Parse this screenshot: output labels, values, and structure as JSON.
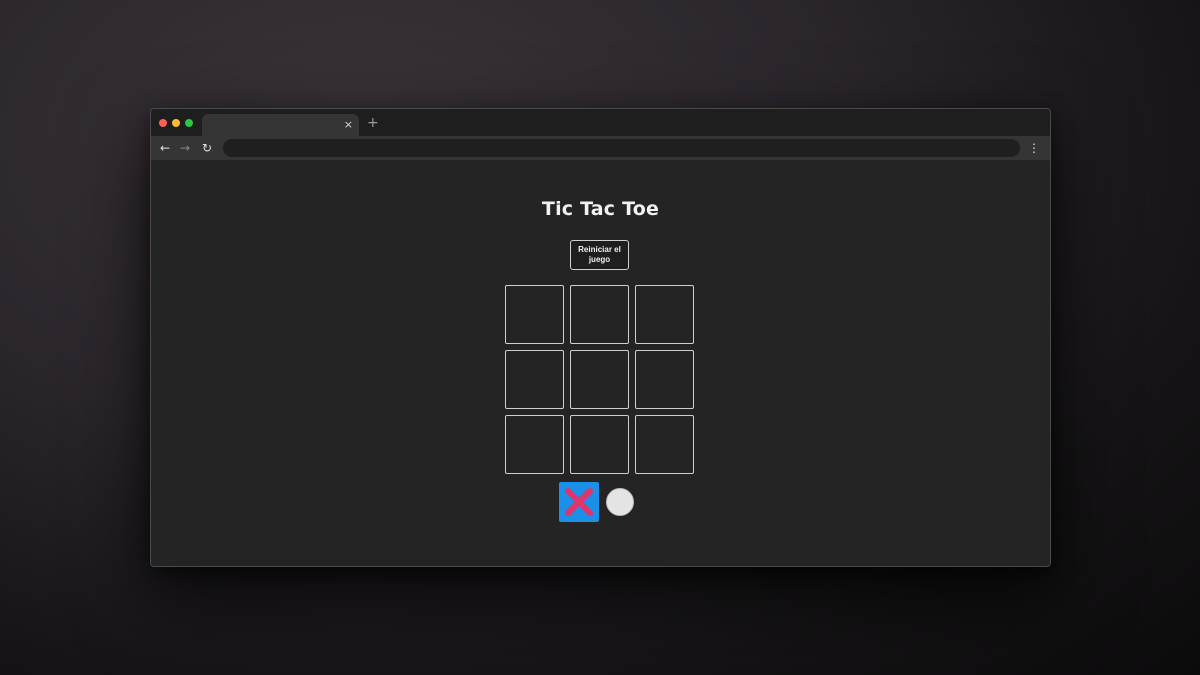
{
  "browser": {
    "tab_close_glyph": "×",
    "new_tab_glyph": "+",
    "back_glyph": "←",
    "forward_glyph": "→",
    "reload_glyph": "↻",
    "menu_glyph": "⋮",
    "address": ""
  },
  "game": {
    "title": "Tic Tac Toe",
    "reset_label": "Reiniciar el juego",
    "board": [
      "",
      "",
      "",
      "",
      "",
      "",
      "",
      "",
      ""
    ],
    "current_turn": "X",
    "turn_indicators": [
      {
        "symbol": "X",
        "active": true,
        "icon": "x-icon",
        "color": "#e2336b",
        "background": "#1c8fe6"
      },
      {
        "symbol": "O",
        "active": false,
        "icon": "o-icon",
        "color": "#e4e4e4"
      }
    ]
  },
  "colors": {
    "background": "#242424",
    "accent": "#1c8fe6",
    "x_mark": "#e2336b"
  }
}
